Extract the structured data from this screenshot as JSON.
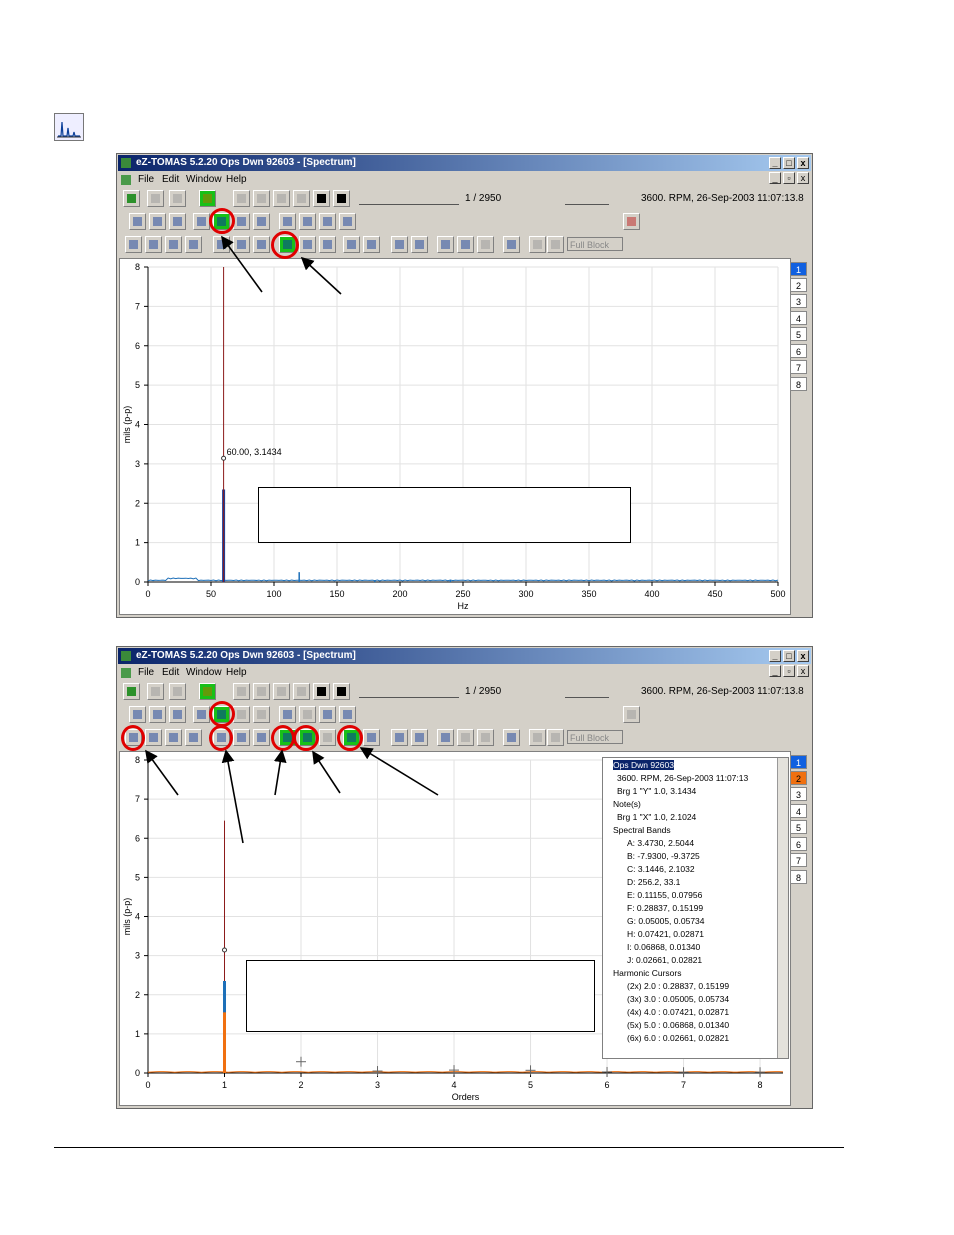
{
  "page": {
    "icon": "spectrum-plot-icon"
  },
  "windows": [
    {
      "title": "eZ-TOMAS 5.2.20    Ops Dwn 92603 - [Spectrum]",
      "title_buttons": [
        "_",
        "□",
        "x"
      ],
      "mdi_buttons": [
        "_",
        "▫",
        "x"
      ],
      "menu": [
        "File",
        "Edit",
        "Window",
        "Help"
      ],
      "counter": "1 / 2950",
      "status": "3600. RPM,   26-Sep-2003 11:07:13.8",
      "combo": "Full Block",
      "tabs": [
        "1",
        "2",
        "3",
        "4",
        "5",
        "6",
        "7",
        "8"
      ],
      "chart_data": {
        "type": "line",
        "xlabel": "Hz",
        "ylabel": "mils (p-p)",
        "xlim": [
          0,
          500
        ],
        "ylim": [
          0,
          8
        ],
        "x_ticks": [
          "0",
          "50",
          "100",
          "150",
          "200",
          "250",
          "300",
          "350",
          "400",
          "450",
          "500"
        ],
        "y_ticks": [
          "0",
          "1",
          "2",
          "3",
          "4",
          "5",
          "6",
          "7",
          "8"
        ],
        "cursor_x": 60,
        "cursor_label": "60.00, 3.1434",
        "peaks": [
          {
            "x": 60,
            "y": 3.1434
          },
          {
            "x": 120,
            "y": 0.25
          },
          {
            "x": 180,
            "y": 0.03
          },
          {
            "x": 240,
            "y": 0.05
          }
        ],
        "colors": {
          "trace": "#1d6fb8",
          "bar": "#1a3f9a",
          "cursor": "#8b1a1a"
        }
      }
    },
    {
      "title": "eZ-TOMAS 5.2.20    Ops Dwn 92603 - [Spectrum]",
      "title_buttons": [
        "_",
        "□",
        "x"
      ],
      "mdi_buttons": [
        "_",
        "▫",
        "x"
      ],
      "menu": [
        "File",
        "Edit",
        "Window",
        "Help"
      ],
      "counter": "1 / 2950",
      "status": "3600. RPM,   26-Sep-2003 11:07:13.8",
      "combo": "Full Block",
      "tabs": [
        "1",
        "2",
        "3",
        "4",
        "5",
        "6",
        "7",
        "8"
      ],
      "tree": [
        "Ops Dwn 92603",
        "3600. RPM,  26-Sep-2003 11:07:13",
        "Brg 1 \"Y\"  1.0, 3.1434",
        "Note(s)",
        "Brg 1 \"X\"  1.0, 2.1024",
        "Spectral Bands",
        "A:  3.4730, 2.5044",
        "B:  -7.9300, -9.3725",
        "C:  3.1446, 2.1032",
        "D:  256.2, 33.1",
        "E:  0.11155, 0.07956",
        "F:  0.28837, 0.15199",
        "G:  0.05005, 0.05734",
        "H:  0.07421, 0.02871",
        "I:  0.06868, 0.01340",
        "J:  0.02661, 0.02821",
        "Harmonic Cursors",
        "(2x)  2.0 :   0.28837, 0.15199",
        "(3x)  3.0 :   0.05005, 0.05734",
        "(4x)  4.0 :   0.07421, 0.02871",
        "(5x)  5.0 :   0.06868, 0.01340",
        "(6x)  6.0 :   0.02661, 0.02821"
      ],
      "chart_data": {
        "type": "line",
        "xlabel": "Orders",
        "ylabel": "mils (p-p)",
        "xlim": [
          0,
          8.3
        ],
        "ylim": [
          0,
          8
        ],
        "x_ticks": [
          "0",
          "1",
          "2",
          "3",
          "4",
          "5",
          "6",
          "7",
          "8"
        ],
        "y_ticks": [
          "0",
          "1",
          "2",
          "3",
          "4",
          "5",
          "6",
          "7",
          "8"
        ],
        "cursor_x": 1,
        "peaks": [
          {
            "x": 1,
            "y": 3.1434
          },
          {
            "x": 2,
            "y": 0.28837
          },
          {
            "x": 3,
            "y": 0.05005
          },
          {
            "x": 4,
            "y": 0.07421
          },
          {
            "x": 5,
            "y": 0.06868
          },
          {
            "x": 6,
            "y": 0.02661
          }
        ],
        "harmonics": [
          2,
          3,
          4,
          5,
          6,
          7,
          8
        ],
        "colors": {
          "trace_y": "#1d6fb8",
          "trace_x": "#f07010",
          "cursor": "#8b1a1a"
        }
      }
    }
  ]
}
